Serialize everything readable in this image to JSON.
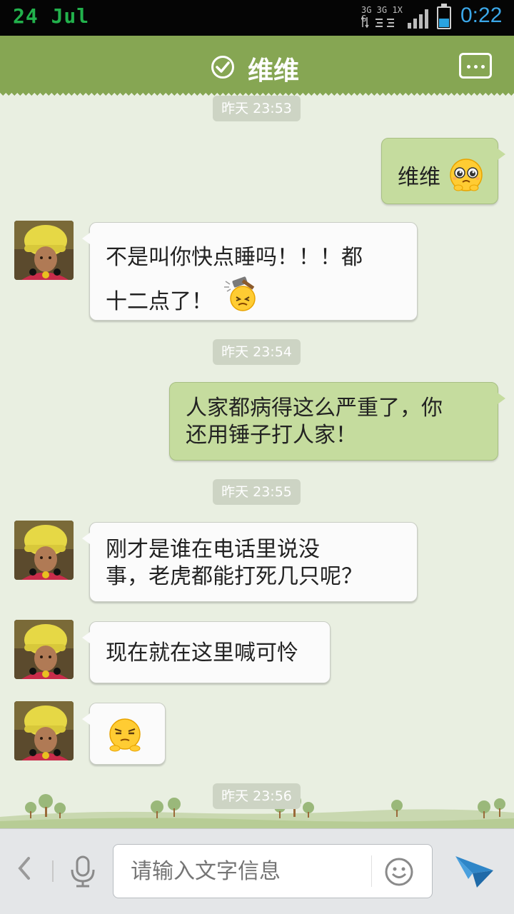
{
  "status_bar": {
    "date": "24  Jul",
    "network_top": "3G 3G 1X  G",
    "time": "0:22",
    "battery_level_percent": 45,
    "colors": {
      "date": "#22b14c",
      "time": "#3ba7e8"
    }
  },
  "header": {
    "title": "维维",
    "verified_icon": "check-circle-icon",
    "menu_icon": "more-dots-icon",
    "color": "#86a653"
  },
  "timestamps": [
    "昨天 23:53",
    "昨天 23:54",
    "昨天 23:55",
    "昨天 23:56"
  ],
  "messages": [
    {
      "side": "out",
      "text": "维维",
      "emoji": "pleading-face"
    },
    {
      "side": "in",
      "text": "不是叫你快点睡吗！！！都\n十二点了！",
      "emoji": "hammer-hit-face"
    },
    {
      "side": "out",
      "text": "人家都病得这么严重了，你\n还用锤子打人家！"
    },
    {
      "side": "in",
      "text": "刚才是谁在电话里说没\n事，老虎都能打死几只呢？"
    },
    {
      "side": "in",
      "text": "现在就在这里喊可怜"
    },
    {
      "side": "in",
      "emoji": "smug-face"
    }
  ],
  "input_bar": {
    "placeholder": "请输入文字信息",
    "icons": [
      "back-chevron-icon",
      "microphone-icon",
      "emoji-icon",
      "send-icon"
    ]
  },
  "colors": {
    "background": "#e9efe1",
    "outgoing_bubble": "#c5dc9e",
    "incoming_bubble": "#fbfbfb",
    "send_accent": "#2f86c8"
  }
}
